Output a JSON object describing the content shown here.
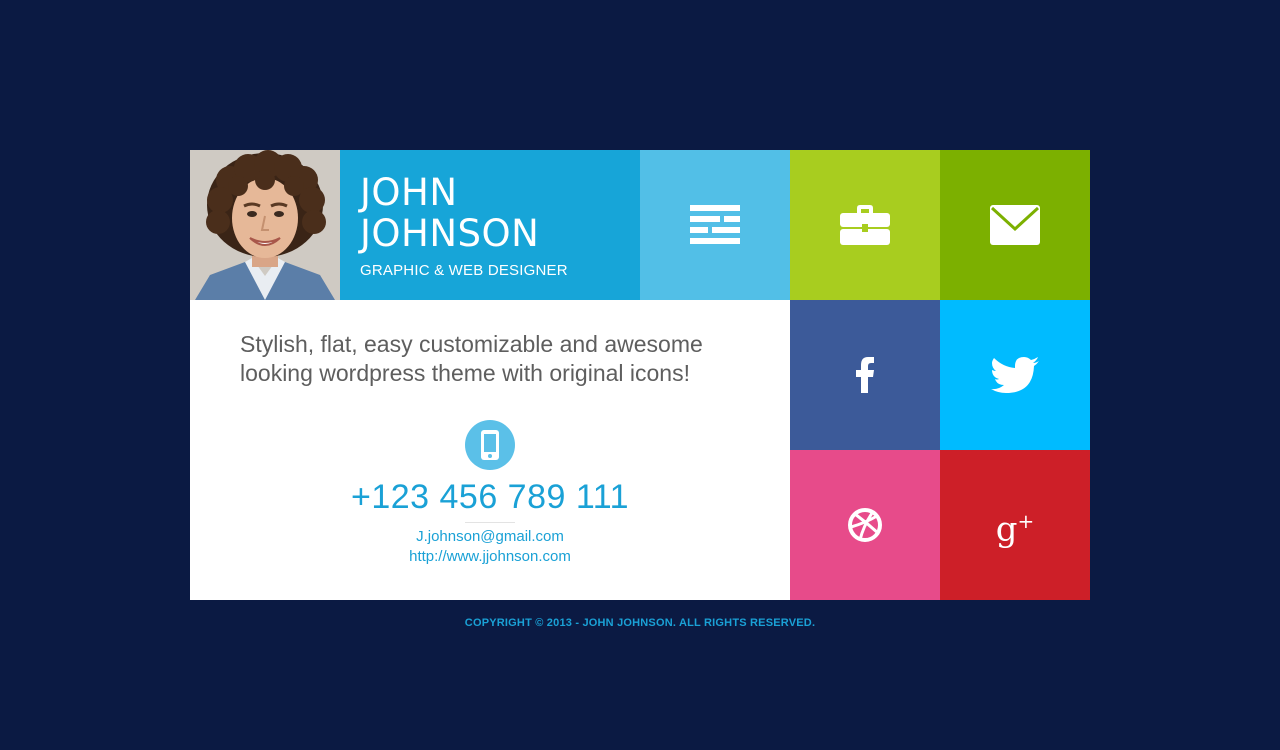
{
  "profile": {
    "first_name": "JOHN",
    "last_name": "JOHNSON",
    "role": "GRAPHIC & WEB DESIGNER"
  },
  "intro": {
    "tagline": "Stylish, flat, easy customizable and awesome looking wordpress theme with original icons!"
  },
  "contact": {
    "phone": "+123 456 789 111",
    "email": "J.johnson@gmail.com",
    "website": "http://www.jjohnson.com"
  },
  "tiles": [
    {
      "name": "menu",
      "icon": "menu-icon",
      "color": "#52bfe7"
    },
    {
      "name": "portfolio",
      "icon": "briefcase-icon",
      "color": "#a8cd1f"
    },
    {
      "name": "mail",
      "icon": "envelope-icon",
      "color": "#7cb000"
    },
    {
      "name": "facebook",
      "icon": "facebook-icon",
      "color": "#3c5a99"
    },
    {
      "name": "twitter",
      "icon": "twitter-icon",
      "color": "#00bbff"
    },
    {
      "name": "dribbble",
      "icon": "dribbble-icon",
      "color": "#e74b8a"
    },
    {
      "name": "google-plus",
      "icon": "google-plus-icon",
      "color": "#cd1f28"
    }
  ],
  "footer": {
    "copyright": "COPYRIGHT © 2013 - JOHN JOHNSON. ALL RIGHTS RESERVED."
  }
}
